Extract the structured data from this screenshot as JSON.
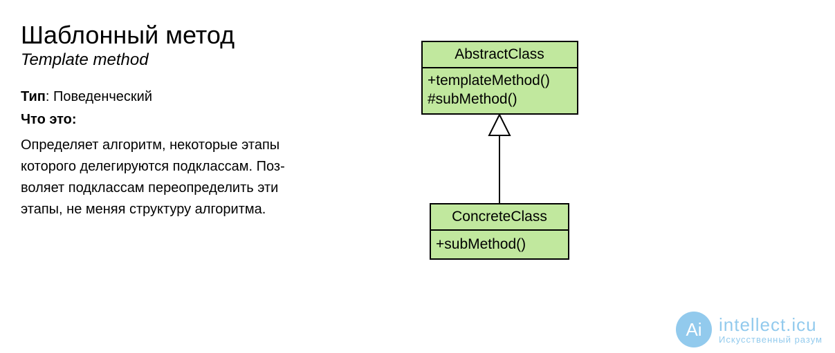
{
  "title_ru": "Шаблонный метод",
  "title_en": "Template method",
  "type_label": "Тип",
  "type_value": "Поведенческий",
  "what_label": "Что это",
  "description": "Определяет алгоритм, некоторые этапы которого делегируются подклассам. Поз­воляет подклассам переопределить эти этапы, не меняя структуру алгоритма.",
  "diagram": {
    "abstract": {
      "name": "AbstractClass",
      "method1": "+templateMethod()",
      "method2": "#subMethod()"
    },
    "concrete": {
      "name": "ConcreteClass",
      "method1": "+subMethod()"
    },
    "fill": "#c1e89e",
    "stroke": "#000000"
  },
  "watermark": {
    "icon": "Ai",
    "main": "intellect.icu",
    "sub": "Искусственный разум"
  }
}
